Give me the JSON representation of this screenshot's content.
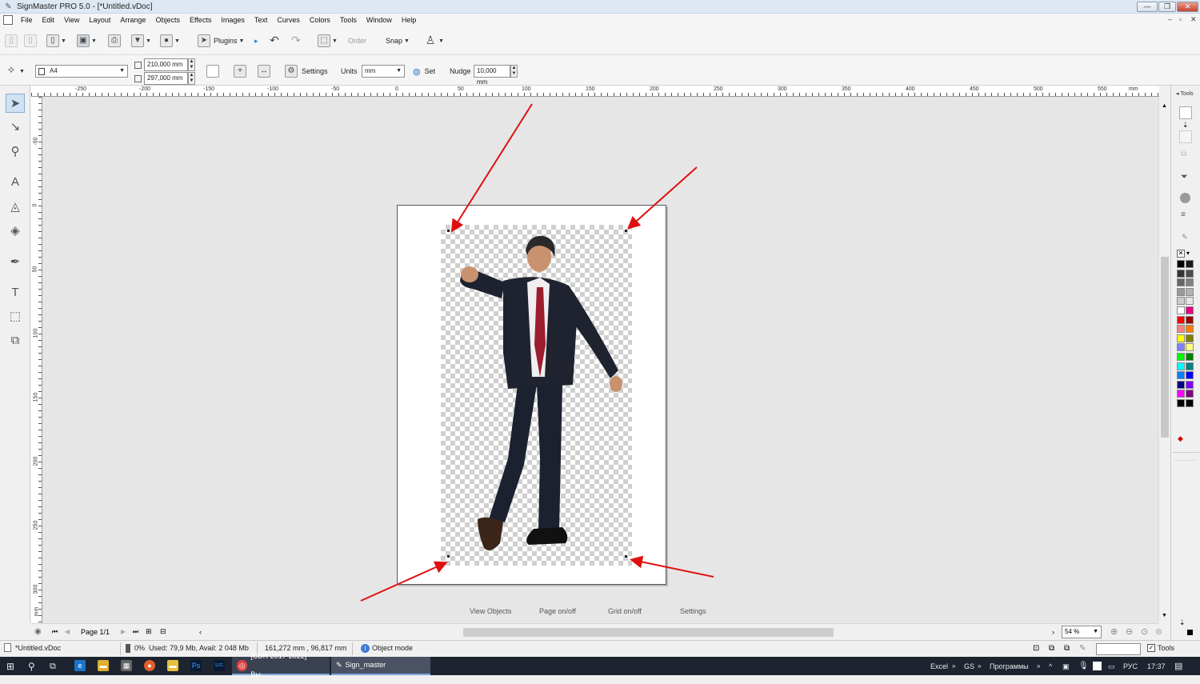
{
  "app": {
    "title": "SignMaster PRO 5.0 - [*Untitled.vDoc]"
  },
  "menu": [
    "File",
    "Edit",
    "View",
    "Layout",
    "Arrange",
    "Objects",
    "Effects",
    "Images",
    "Text",
    "Curves",
    "Colors",
    "Tools",
    "Window",
    "Help"
  ],
  "toolbar1": {
    "plugins_label": "Plugins",
    "order_label": "Order",
    "snap_label": "Snap"
  },
  "toolbar2": {
    "page_size": "A4",
    "width": "210,000 mm",
    "height": "297,000 mm",
    "settings_label": "Settings",
    "units_label": "Units",
    "units_value": "mm",
    "set_label": "Set",
    "nudge_label": "Nudge",
    "nudge_value": "10,000 mm"
  },
  "rulers": {
    "h_labels": [
      "-250",
      "-200",
      "-150",
      "-100",
      "-50",
      "0",
      "50",
      "100",
      "150",
      "200",
      "250",
      "300",
      "350",
      "400",
      "450",
      "500",
      "550",
      "mm"
    ],
    "v_labels": [
      "-50",
      "0",
      "50",
      "100",
      "150",
      "200",
      "250",
      "300",
      "mm"
    ]
  },
  "canvas_links": {
    "view_objects": "View Objects",
    "page_onoff": "Page on/off",
    "grid_onoff": "Grid on/off",
    "settings": "Settings"
  },
  "right_panel": {
    "tools_label": "Tools",
    "palette": [
      "#000000",
      "#1a1a1a",
      "#333333",
      "#4d4d4d",
      "#666666",
      "#808080",
      "#999999",
      "#b3b3b3",
      "#cccccc",
      "#e6e6e6",
      "#ffffff",
      "#e6007e",
      "#ff0000",
      "#990000",
      "#ff8080",
      "#ff8000",
      "#ffff00",
      "#808000",
      "#8080ff",
      "#ffff80",
      "#00ff00",
      "#008000",
      "#00ffff",
      "#008080",
      "#0080ff",
      "#0000ff",
      "#000080",
      "#8000ff",
      "#ff00ff",
      "#800080",
      "#000000",
      "#000000"
    ]
  },
  "navigation": {
    "page_label": "Page 1/1",
    "zoom_value": "54 %"
  },
  "status": {
    "doc_name": "*Untitled.vDoc",
    "percent": "0%",
    "memory": "Used: 79,9 Mb, Avail: 2 048 Mb",
    "coords": "161,272 mm , 96,817 mm",
    "mode": "Object mode",
    "tools_check": "Tools"
  },
  "taskbar": {
    "task1": "[CDR 2017-2022] - Вы...",
    "task2": "Sign_master",
    "tray": [
      "Excel",
      "GS",
      "Программы"
    ],
    "lang": "РУС",
    "time": "17:37",
    "ps_label": "Ps",
    "lrc_label": "Lrc"
  }
}
